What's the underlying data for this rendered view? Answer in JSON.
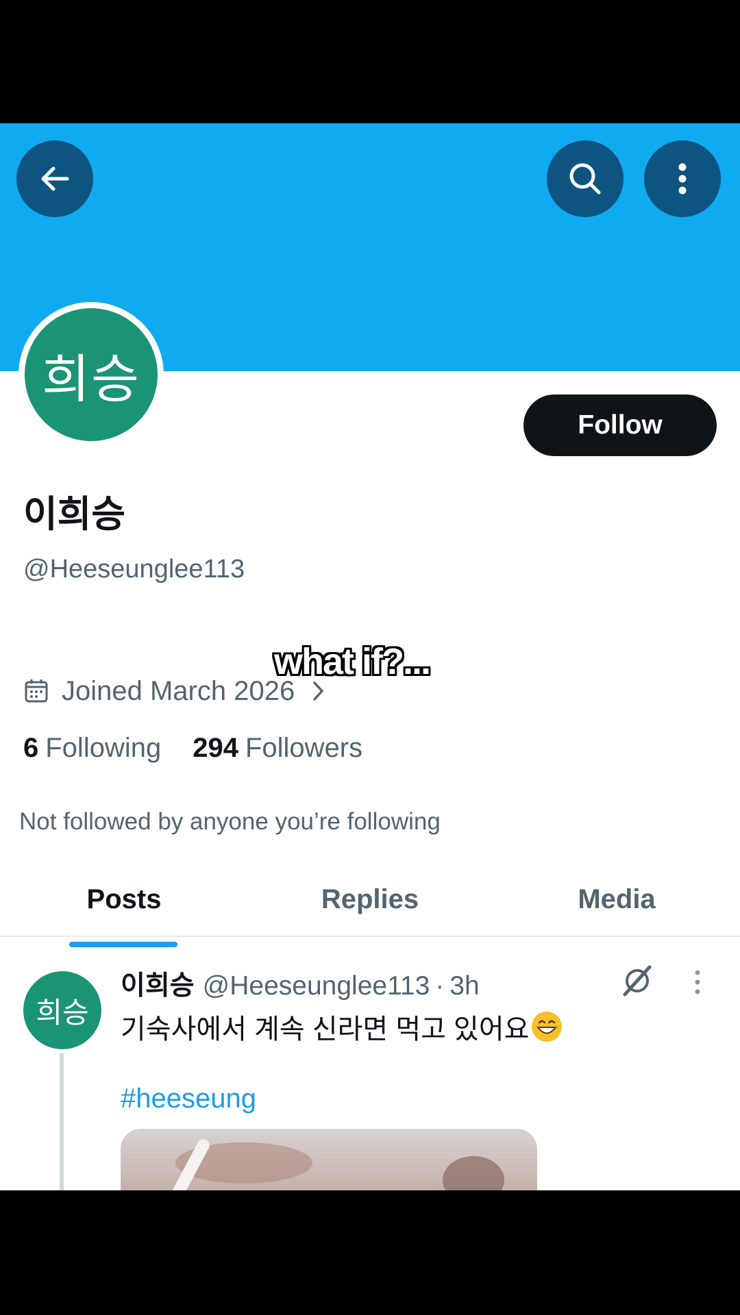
{
  "profile": {
    "avatar_text": "희승",
    "display_name": "이희승",
    "handle": "@Heeseunglee113",
    "joined": "Joined March 2026",
    "following_count": "6",
    "following_label": "Following",
    "followers_count": "294",
    "followers_label": "Followers",
    "not_followed_text": "Not followed by anyone you’re following"
  },
  "actions": {
    "follow_label": "Follow"
  },
  "overlay": {
    "caption": "what if?..."
  },
  "tabs": [
    {
      "label": "Posts",
      "active": true
    },
    {
      "label": "Replies",
      "active": false
    },
    {
      "label": "Media",
      "active": false
    }
  ],
  "post": {
    "avatar_text": "희승",
    "name": "이희승",
    "handle": "@Heeseunglee113",
    "dot": "·",
    "time": "3h",
    "text": "기숙사에서 계속 신라면 먹고 있어요",
    "emoji": "grinning-face-with-smiling-eyes",
    "hashtag": "#heeseung"
  },
  "colors": {
    "banner": "#10aaf0",
    "button_dark": "#0d5580",
    "avatar": "#1a9475",
    "accent": "#1d9bf0",
    "text_primary": "#0f1419",
    "text_secondary": "#536471"
  },
  "icons": [
    "back-arrow-icon",
    "search-icon",
    "more-vertical-icon",
    "calendar-icon",
    "chevron-right-icon",
    "grok-icon",
    "post-more-icon"
  ]
}
